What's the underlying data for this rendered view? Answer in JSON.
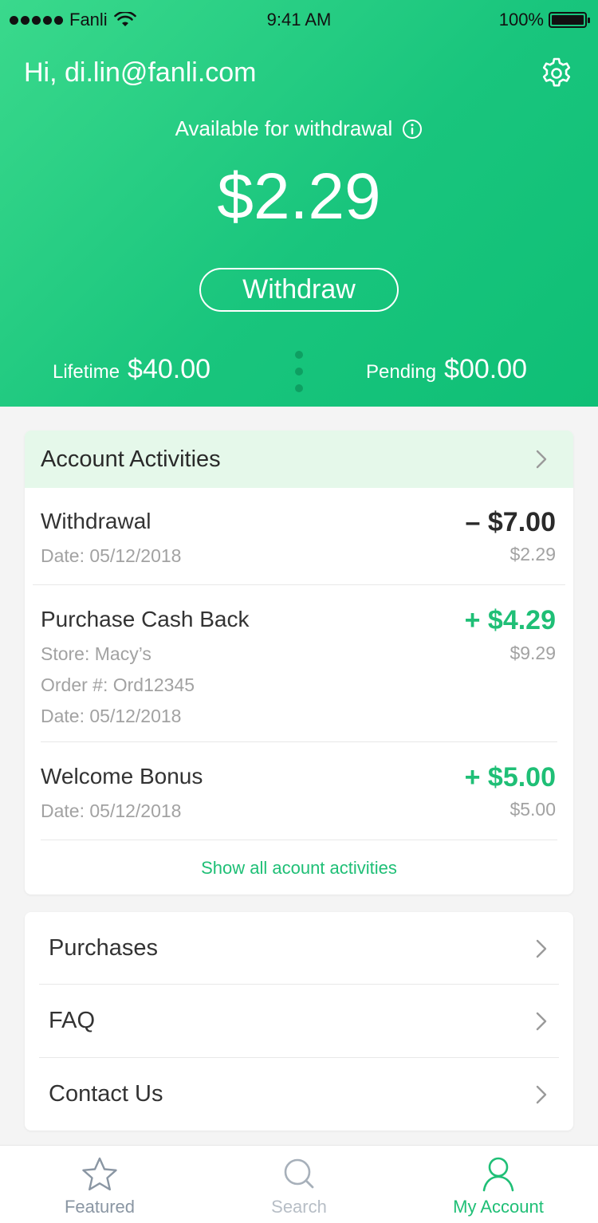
{
  "status_bar": {
    "carrier": "Fanli",
    "time": "9:41 AM",
    "battery": "100%"
  },
  "header": {
    "greeting": "Hi, di.lin@fanli.com",
    "available_label": "Available for withdrawal",
    "balance": "$2.29",
    "withdraw_label": "Withdraw",
    "lifetime_label": "Lifetime",
    "lifetime_value": "$40.00",
    "pending_label": "Pending",
    "pending_value": "$00.00"
  },
  "activities": {
    "title": "Account Activities",
    "items": [
      {
        "title": "Withdrawal",
        "details": [
          "Date: 05/12/2018"
        ],
        "amount": "– $7.00",
        "balance": "$2.29"
      },
      {
        "title": "Purchase Cash Back",
        "details": [
          "Store: Macy’s",
          "Order #: Ord12345",
          "Date: 05/12/2018"
        ],
        "amount": "+ $4.29",
        "balance": "$9.29"
      },
      {
        "title": "Welcome Bonus",
        "details": [
          "Date: 05/12/2018"
        ],
        "amount": "+ $5.00",
        "balance": "$5.00"
      }
    ],
    "show_all": "Show all acount activities"
  },
  "links": [
    {
      "label": "Purchases"
    },
    {
      "label": "FAQ"
    },
    {
      "label": "Contact Us"
    }
  ],
  "tabs": [
    {
      "label": "Featured",
      "icon": "star-icon"
    },
    {
      "label": "Search",
      "icon": "search-icon"
    },
    {
      "label": "My Account",
      "icon": "user-icon"
    }
  ],
  "colors": {
    "brand_green": "#1fbf76",
    "activities_header_bg": "#e5f8ea",
    "muted_text": "#a2a2a2"
  }
}
